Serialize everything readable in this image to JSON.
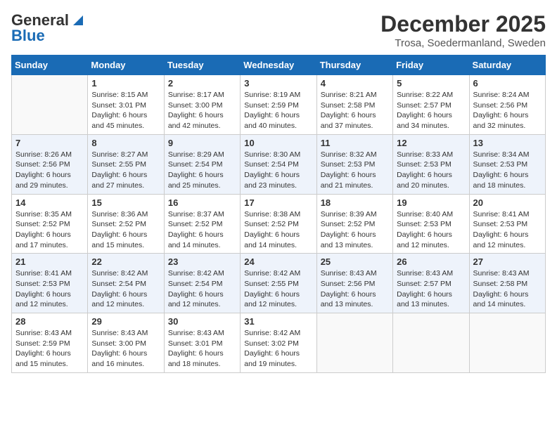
{
  "logo": {
    "line1": "General",
    "line2": "Blue"
  },
  "title": "December 2025",
  "location": "Trosa, Soedermanland, Sweden",
  "days_header": [
    "Sunday",
    "Monday",
    "Tuesday",
    "Wednesday",
    "Thursday",
    "Friday",
    "Saturday"
  ],
  "weeks": [
    [
      {
        "day": "",
        "info": ""
      },
      {
        "day": "1",
        "info": "Sunrise: 8:15 AM\nSunset: 3:01 PM\nDaylight: 6 hours\nand 45 minutes."
      },
      {
        "day": "2",
        "info": "Sunrise: 8:17 AM\nSunset: 3:00 PM\nDaylight: 6 hours\nand 42 minutes."
      },
      {
        "day": "3",
        "info": "Sunrise: 8:19 AM\nSunset: 2:59 PM\nDaylight: 6 hours\nand 40 minutes."
      },
      {
        "day": "4",
        "info": "Sunrise: 8:21 AM\nSunset: 2:58 PM\nDaylight: 6 hours\nand 37 minutes."
      },
      {
        "day": "5",
        "info": "Sunrise: 8:22 AM\nSunset: 2:57 PM\nDaylight: 6 hours\nand 34 minutes."
      },
      {
        "day": "6",
        "info": "Sunrise: 8:24 AM\nSunset: 2:56 PM\nDaylight: 6 hours\nand 32 minutes."
      }
    ],
    [
      {
        "day": "7",
        "info": "Sunrise: 8:26 AM\nSunset: 2:56 PM\nDaylight: 6 hours\nand 29 minutes."
      },
      {
        "day": "8",
        "info": "Sunrise: 8:27 AM\nSunset: 2:55 PM\nDaylight: 6 hours\nand 27 minutes."
      },
      {
        "day": "9",
        "info": "Sunrise: 8:29 AM\nSunset: 2:54 PM\nDaylight: 6 hours\nand 25 minutes."
      },
      {
        "day": "10",
        "info": "Sunrise: 8:30 AM\nSunset: 2:54 PM\nDaylight: 6 hours\nand 23 minutes."
      },
      {
        "day": "11",
        "info": "Sunrise: 8:32 AM\nSunset: 2:53 PM\nDaylight: 6 hours\nand 21 minutes."
      },
      {
        "day": "12",
        "info": "Sunrise: 8:33 AM\nSunset: 2:53 PM\nDaylight: 6 hours\nand 20 minutes."
      },
      {
        "day": "13",
        "info": "Sunrise: 8:34 AM\nSunset: 2:53 PM\nDaylight: 6 hours\nand 18 minutes."
      }
    ],
    [
      {
        "day": "14",
        "info": "Sunrise: 8:35 AM\nSunset: 2:52 PM\nDaylight: 6 hours\nand 17 minutes."
      },
      {
        "day": "15",
        "info": "Sunrise: 8:36 AM\nSunset: 2:52 PM\nDaylight: 6 hours\nand 15 minutes."
      },
      {
        "day": "16",
        "info": "Sunrise: 8:37 AM\nSunset: 2:52 PM\nDaylight: 6 hours\nand 14 minutes."
      },
      {
        "day": "17",
        "info": "Sunrise: 8:38 AM\nSunset: 2:52 PM\nDaylight: 6 hours\nand 14 minutes."
      },
      {
        "day": "18",
        "info": "Sunrise: 8:39 AM\nSunset: 2:52 PM\nDaylight: 6 hours\nand 13 minutes."
      },
      {
        "day": "19",
        "info": "Sunrise: 8:40 AM\nSunset: 2:53 PM\nDaylight: 6 hours\nand 12 minutes."
      },
      {
        "day": "20",
        "info": "Sunrise: 8:41 AM\nSunset: 2:53 PM\nDaylight: 6 hours\nand 12 minutes."
      }
    ],
    [
      {
        "day": "21",
        "info": "Sunrise: 8:41 AM\nSunset: 2:53 PM\nDaylight: 6 hours\nand 12 minutes."
      },
      {
        "day": "22",
        "info": "Sunrise: 8:42 AM\nSunset: 2:54 PM\nDaylight: 6 hours\nand 12 minutes."
      },
      {
        "day": "23",
        "info": "Sunrise: 8:42 AM\nSunset: 2:54 PM\nDaylight: 6 hours\nand 12 minutes."
      },
      {
        "day": "24",
        "info": "Sunrise: 8:42 AM\nSunset: 2:55 PM\nDaylight: 6 hours\nand 12 minutes."
      },
      {
        "day": "25",
        "info": "Sunrise: 8:43 AM\nSunset: 2:56 PM\nDaylight: 6 hours\nand 13 minutes."
      },
      {
        "day": "26",
        "info": "Sunrise: 8:43 AM\nSunset: 2:57 PM\nDaylight: 6 hours\nand 13 minutes."
      },
      {
        "day": "27",
        "info": "Sunrise: 8:43 AM\nSunset: 2:58 PM\nDaylight: 6 hours\nand 14 minutes."
      }
    ],
    [
      {
        "day": "28",
        "info": "Sunrise: 8:43 AM\nSunset: 2:59 PM\nDaylight: 6 hours\nand 15 minutes."
      },
      {
        "day": "29",
        "info": "Sunrise: 8:43 AM\nSunset: 3:00 PM\nDaylight: 6 hours\nand 16 minutes."
      },
      {
        "day": "30",
        "info": "Sunrise: 8:43 AM\nSunset: 3:01 PM\nDaylight: 6 hours\nand 18 minutes."
      },
      {
        "day": "31",
        "info": "Sunrise: 8:42 AM\nSunset: 3:02 PM\nDaylight: 6 hours\nand 19 minutes."
      },
      {
        "day": "",
        "info": ""
      },
      {
        "day": "",
        "info": ""
      },
      {
        "day": "",
        "info": ""
      }
    ]
  ]
}
